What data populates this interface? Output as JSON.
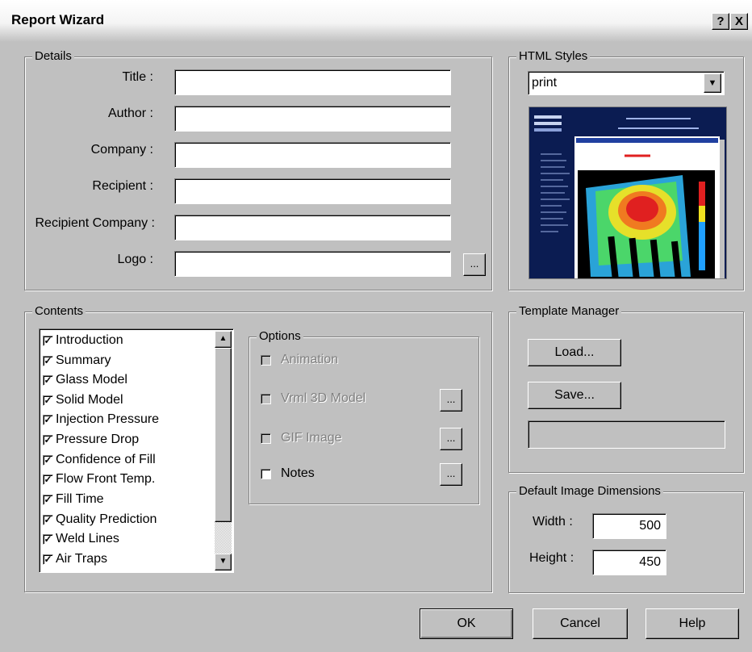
{
  "window": {
    "title": "Report Wizard",
    "help_glyph": "?",
    "close_glyph": "X"
  },
  "details": {
    "legend": "Details",
    "fields": [
      {
        "label": "Title :",
        "value": ""
      },
      {
        "label": "Author :",
        "value": ""
      },
      {
        "label": "Company :",
        "value": ""
      },
      {
        "label": "Recipient :",
        "value": ""
      },
      {
        "label": "Recipient Company :",
        "value": ""
      },
      {
        "label": "Logo :",
        "value": ""
      }
    ],
    "browse_label": "..."
  },
  "html_styles": {
    "legend": "HTML Styles",
    "selected": "print",
    "preview_icon": "report-preview-thumbnail"
  },
  "contents": {
    "legend": "Contents",
    "items": [
      {
        "label": "Introduction",
        "checked": true
      },
      {
        "label": "Summary",
        "checked": true
      },
      {
        "label": "Glass Model",
        "checked": true
      },
      {
        "label": "Solid Model",
        "checked": true
      },
      {
        "label": "Injection Pressure",
        "checked": true
      },
      {
        "label": "Pressure Drop",
        "checked": true
      },
      {
        "label": "Confidence of Fill",
        "checked": true
      },
      {
        "label": "Flow Front Temp.",
        "checked": true
      },
      {
        "label": "Fill Time",
        "checked": true
      },
      {
        "label": "Quality Prediction",
        "checked": true
      },
      {
        "label": "Weld Lines",
        "checked": true
      },
      {
        "label": "Air Traps",
        "checked": true
      }
    ]
  },
  "options": {
    "legend": "Options",
    "items": [
      {
        "label": "Animation",
        "enabled": false,
        "checked": false,
        "has_button": false
      },
      {
        "label": "Vrml 3D Model",
        "enabled": false,
        "checked": false,
        "has_button": true
      },
      {
        "label": "GIF Image",
        "enabled": false,
        "checked": false,
        "has_button": true
      },
      {
        "label": "Notes",
        "enabled": true,
        "checked": false,
        "has_button": true
      }
    ],
    "browse_label": "..."
  },
  "template_manager": {
    "legend": "Template Manager",
    "load_label": "Load...",
    "save_label": "Save...",
    "template_name": ""
  },
  "image_dimensions": {
    "legend": "Default Image Dimensions",
    "width_label": "Width :",
    "width_value": "500",
    "height_label": "Height :",
    "height_value": "450"
  },
  "footer": {
    "ok_label": "OK",
    "cancel_label": "Cancel",
    "help_label": "Help"
  }
}
